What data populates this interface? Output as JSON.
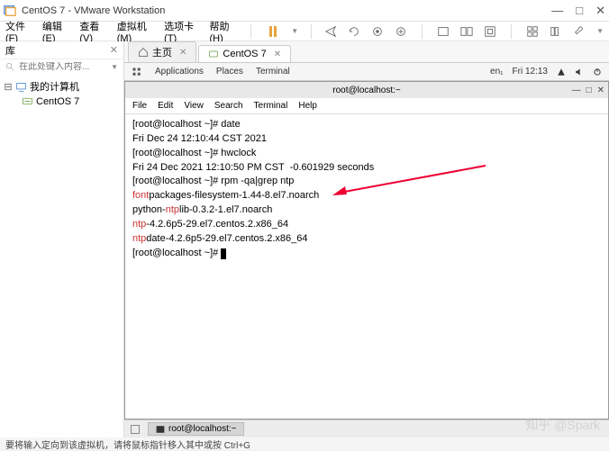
{
  "window": {
    "title": "CentOS 7 - VMware Workstation",
    "min": "—",
    "max": "□",
    "close": "✕"
  },
  "menu": {
    "file": "文件(F)",
    "edit": "编辑(E)",
    "view": "查看(V)",
    "vm": "虚拟机(M)",
    "tabs": "选项卡(T)",
    "help": "帮助(H)"
  },
  "sidebar": {
    "header": "库",
    "search_placeholder": "在此处键入内容...",
    "root": "我的计算机",
    "child": "CentOS 7"
  },
  "tabs": {
    "home": "主页",
    "vm": "CentOS 7"
  },
  "gnome": {
    "apps": "Applications",
    "places": "Places",
    "terminal": "Terminal",
    "lang": "en₁",
    "time": "Fri 12:13"
  },
  "terminal": {
    "title": "root@localhost:~",
    "menu": {
      "file": "File",
      "edit": "Edit",
      "view": "View",
      "search": "Search",
      "term": "Terminal",
      "help": "Help"
    },
    "lines": {
      "l1": "[root@localhost ~]# date",
      "l2": "Fri Dec 24 12:10:44 CST 2021",
      "l3": "[root@localhost ~]# hwclock",
      "l4": "Fri 24 Dec 2021 12:10:50 PM CST  -0.601929 seconds",
      "l5": "[root@localhost ~]# rpm -qa|grep ntp",
      "l6a": "font",
      "l6b": "packages-filesystem-1.44-8.el7.noarch",
      "l7a": "python-",
      "l7b": "ntp",
      "l7c": "lib-0.3.2-1.el7.noarch",
      "l8a": "ntp",
      "l8b": "-4.2.6p5-29.el7.centos.2.x86_64",
      "l9a": "ntp",
      "l9b": "date-4.2.6p5-29.el7.centos.2.x86_64",
      "l10": "[root@localhost ~]# "
    }
  },
  "taskbar": {
    "item": "root@localhost:~"
  },
  "status": "要将输入定向到该虚拟机，请将鼠标指针移入其中或按 Ctrl+G",
  "watermark": "知乎 @Spark"
}
